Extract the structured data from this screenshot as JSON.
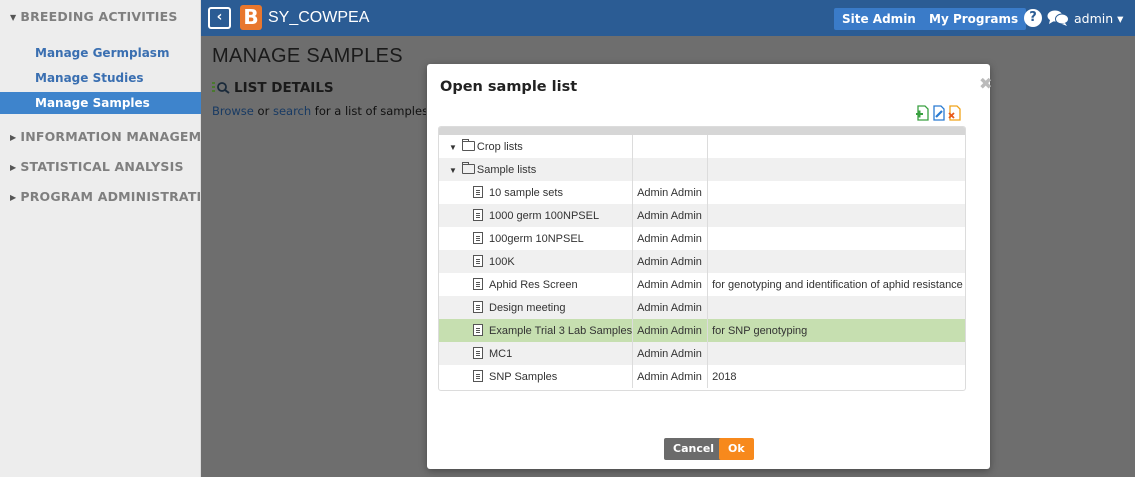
{
  "sidebar": {
    "sections": [
      {
        "label": "BREEDING ACTIVITIES",
        "expanded": true,
        "marker": "▼"
      },
      {
        "label": "INFORMATION MANAGEMENT",
        "expanded": false,
        "marker": "▶"
      },
      {
        "label": "STATISTICAL ANALYSIS",
        "expanded": false,
        "marker": "▶"
      },
      {
        "label": "PROGRAM ADMINISTRATION",
        "expanded": false,
        "marker": "▶"
      }
    ],
    "items": [
      {
        "label": "Manage Germplasm"
      },
      {
        "label": "Manage Studies"
      },
      {
        "label": "Manage Samples",
        "active": true
      }
    ]
  },
  "header": {
    "back_icon": "‹",
    "logo_letter": "B",
    "app_title": "SY_COWPEA",
    "site_admin_label": "Site Admin",
    "my_programs_label": "My Programs",
    "help_icon": "?",
    "user_label": "admin ▾"
  },
  "main": {
    "page_title": "MANAGE SAMPLES",
    "section_title": "LIST DETAILS",
    "browse_link": "Browse",
    "or_text": " or ",
    "search_link": "search",
    "browse_rest": " for a list of samples to work with"
  },
  "modal": {
    "title": "Open sample list",
    "close_icon": "✖",
    "tree": [
      {
        "type": "folder",
        "name": "Crop lists",
        "owner": "",
        "description": ""
      },
      {
        "type": "folder",
        "name": "Sample lists",
        "owner": "",
        "description": ""
      },
      {
        "type": "file",
        "name": "10 sample sets",
        "owner": "Admin Admin",
        "description": ""
      },
      {
        "type": "file",
        "name": "1000 germ 100NPSEL",
        "owner": "Admin Admin",
        "description": ""
      },
      {
        "type": "file",
        "name": "100germ 10NPSEL",
        "owner": "Admin Admin",
        "description": ""
      },
      {
        "type": "file",
        "name": "100K",
        "owner": "Admin Admin",
        "description": ""
      },
      {
        "type": "file",
        "name": "Aphid Res Screen",
        "owner": "Admin Admin",
        "description": "for genotyping and identification of aphid resistance"
      },
      {
        "type": "file",
        "name": "Design meeting",
        "owner": "Admin Admin",
        "description": ""
      },
      {
        "type": "file",
        "name": "Example Trial 3 Lab Samples",
        "owner": "Admin Admin",
        "description": "for SNP genotyping",
        "selected": true
      },
      {
        "type": "file",
        "name": "MC1",
        "owner": "Admin Admin",
        "description": ""
      },
      {
        "type": "file",
        "name": "SNP Samples",
        "owner": "Admin Admin",
        "description": "2018"
      }
    ],
    "cancel_label": "Cancel",
    "ok_label": "Ok"
  },
  "colors": {
    "topbar": "#2b5c94",
    "nav_button": "#3a7bc8",
    "active_sidebar": "#3e84cc",
    "selected_row": "#c6dfb0",
    "ok_button": "#f7891c",
    "logo": "#e8772e"
  }
}
